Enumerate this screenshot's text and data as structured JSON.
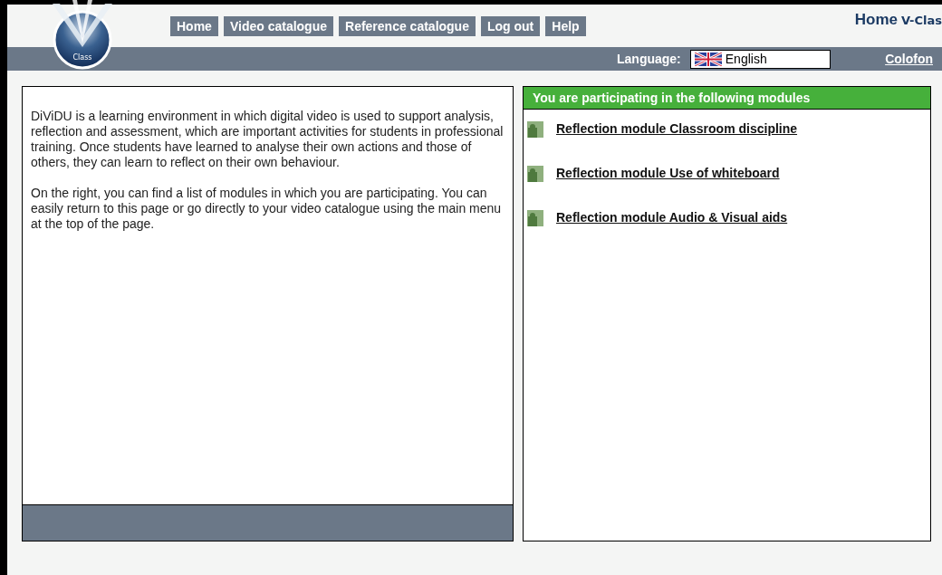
{
  "menu": [
    {
      "label": "Home"
    },
    {
      "label": "Video catalogue"
    },
    {
      "label": "Reference catalogue"
    },
    {
      "label": "Log out"
    },
    {
      "label": "Help"
    }
  ],
  "logo": {
    "caption": "Class"
  },
  "page_title": {
    "title": "Home",
    "brand": "V-Clas"
  },
  "language": {
    "label": "Language:",
    "value": "English"
  },
  "colofon": "Colofon",
  "intro": [
    "DiViDU is a learning environment in which digital video is used to support analysis, reflection and assessment, which are important activities for students in professional training. Once students have learned to analyse their own actions and those of others, they can learn to reflect on their own behaviour.",
    "On the right, you can find a list of modules in which you are participating. You can easily return to this page or go directly to your video catalogue using the main menu at the top of the page."
  ],
  "modules": {
    "title": "You are participating in the following modules",
    "items": [
      {
        "label": "Reflection module Classroom discipline"
      },
      {
        "label": "Reflection module Use of whiteboard"
      },
      {
        "label": "Reflection module Audio & Visual aids"
      }
    ]
  }
}
